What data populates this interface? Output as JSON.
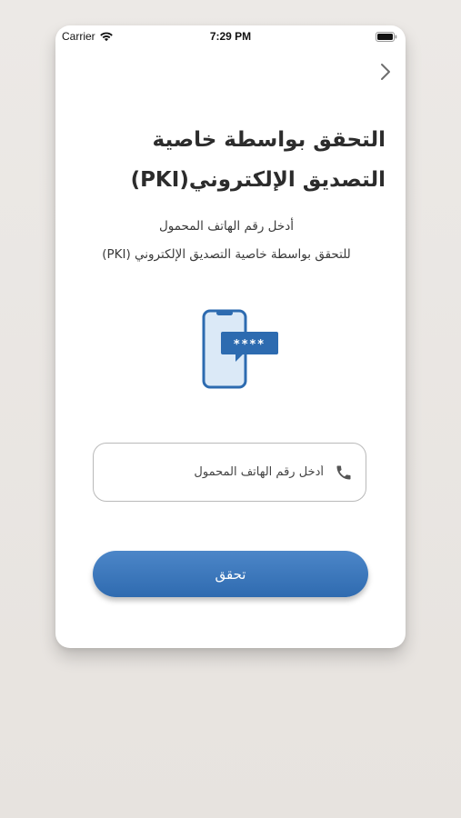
{
  "status_bar": {
    "carrier": "Carrier",
    "time": "7:29 PM"
  },
  "header": {
    "title_line1": "التحقق بواسطة خاصية",
    "title_line2": "التصديق الإلكتروني(PKI)"
  },
  "description": {
    "line1": "أدخل رقم الهاتف المحمول",
    "line2": "للتحقق بواسطة خاصية التصديق الإلكتروني (PKI)"
  },
  "illustration": {
    "otp_mask": "****",
    "icon": "phone-otp-icon"
  },
  "phone_input": {
    "placeholder": "أدخل رقم الهاتف المحمول",
    "value": "",
    "icon": "phone-icon"
  },
  "actions": {
    "verify_label": "تحقق"
  },
  "colors": {
    "accent": "#2f6bb0",
    "accent_light": "#4c86c8",
    "background": "#ebe8e5",
    "card": "#ffffff"
  }
}
